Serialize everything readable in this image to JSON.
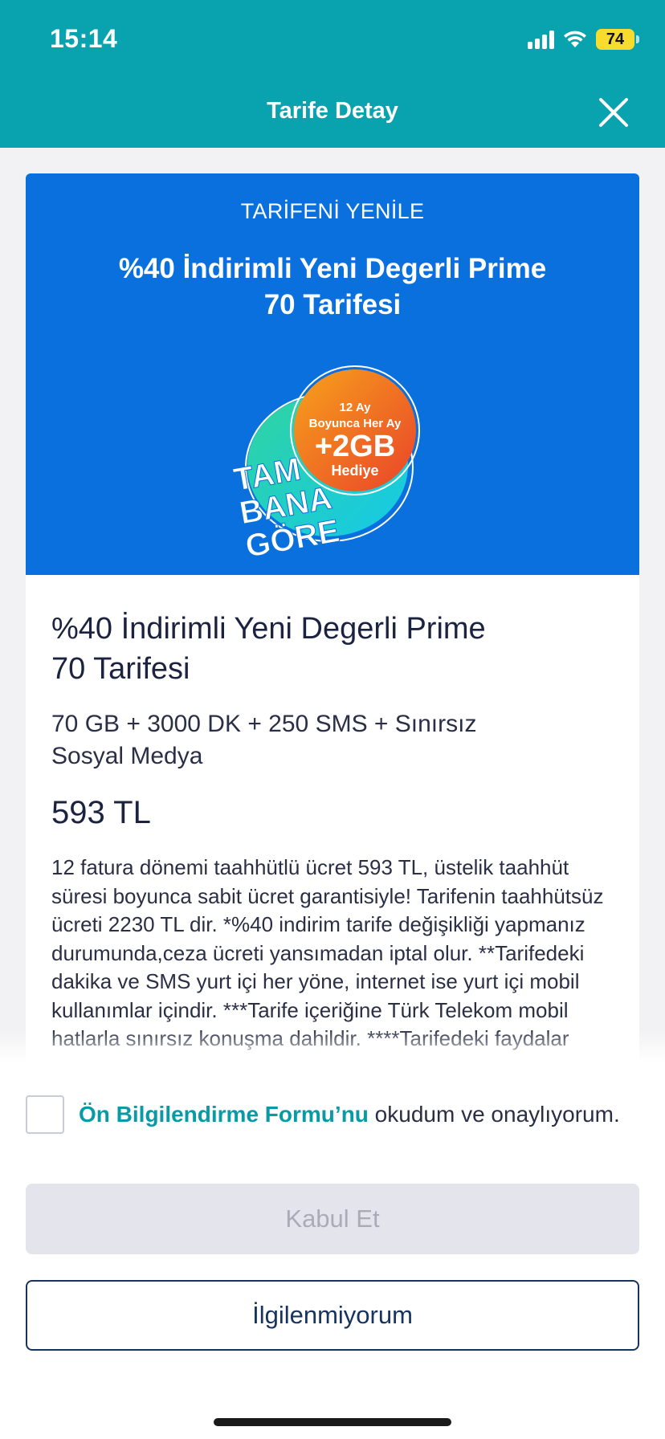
{
  "status_bar": {
    "time": "15:14",
    "battery": "74"
  },
  "header": {
    "title": "Tarife Detay",
    "close_icon": "close-icon"
  },
  "hero": {
    "eyebrow": "TARİFENİ YENİLE",
    "title_line1": "%40 İndirimli Yeni Degerli Prime",
    "title_line2": "70 Tarifesi",
    "badge": {
      "top_line1": "12 Ay",
      "top_line2": "Boyunca Her Ay",
      "amount": "+2GB",
      "gift": "Hediye",
      "slogan_line1": "TAM",
      "slogan_line2": "BANA",
      "slogan_line3": "GÖRE"
    }
  },
  "plan": {
    "name_line1": "%40 İndirimli Yeni Degerli Prime",
    "name_line2": "70 Tarifesi",
    "features_line1": "70 GB + 3000 DK + 250 SMS + Sınırsız",
    "features_line2": "Sosyal Medya",
    "price": "593 TL",
    "description": "12 fatura dönemi taahhütlü ücret 593 TL, üstelik taahhüt süresi boyunca sabit ücret garantisiyle! Tarifenin taahhütsüz ücreti 2230 TL dir. *%40 indirim tarife değişikliği yapmanız durumunda,ceza ücreti yansımadan iptal olur. **Tarifedeki dakika ve SMS yurt içi her yöne, internet ise yurt içi mobil kullanımlar içindir.  ***Tarife içeriğine Türk Telekom mobil hatlarla sınırsız konuşma dahildir.  ****Tarifedeki faydalar"
  },
  "consent": {
    "link_text": "Ön Bilgilendirme Formu’nu",
    "rest_text": " okudum ve onaylıyorum.",
    "checked": false
  },
  "buttons": {
    "accept": "Kabul Et",
    "decline": "İlgilenmiyorum"
  },
  "colors": {
    "header_bg": "#08a3ae",
    "hero_bg": "#0a70dd",
    "link": "#0a9aa6",
    "decline_border": "#17345e",
    "accept_disabled_bg": "#e4e4ec"
  }
}
